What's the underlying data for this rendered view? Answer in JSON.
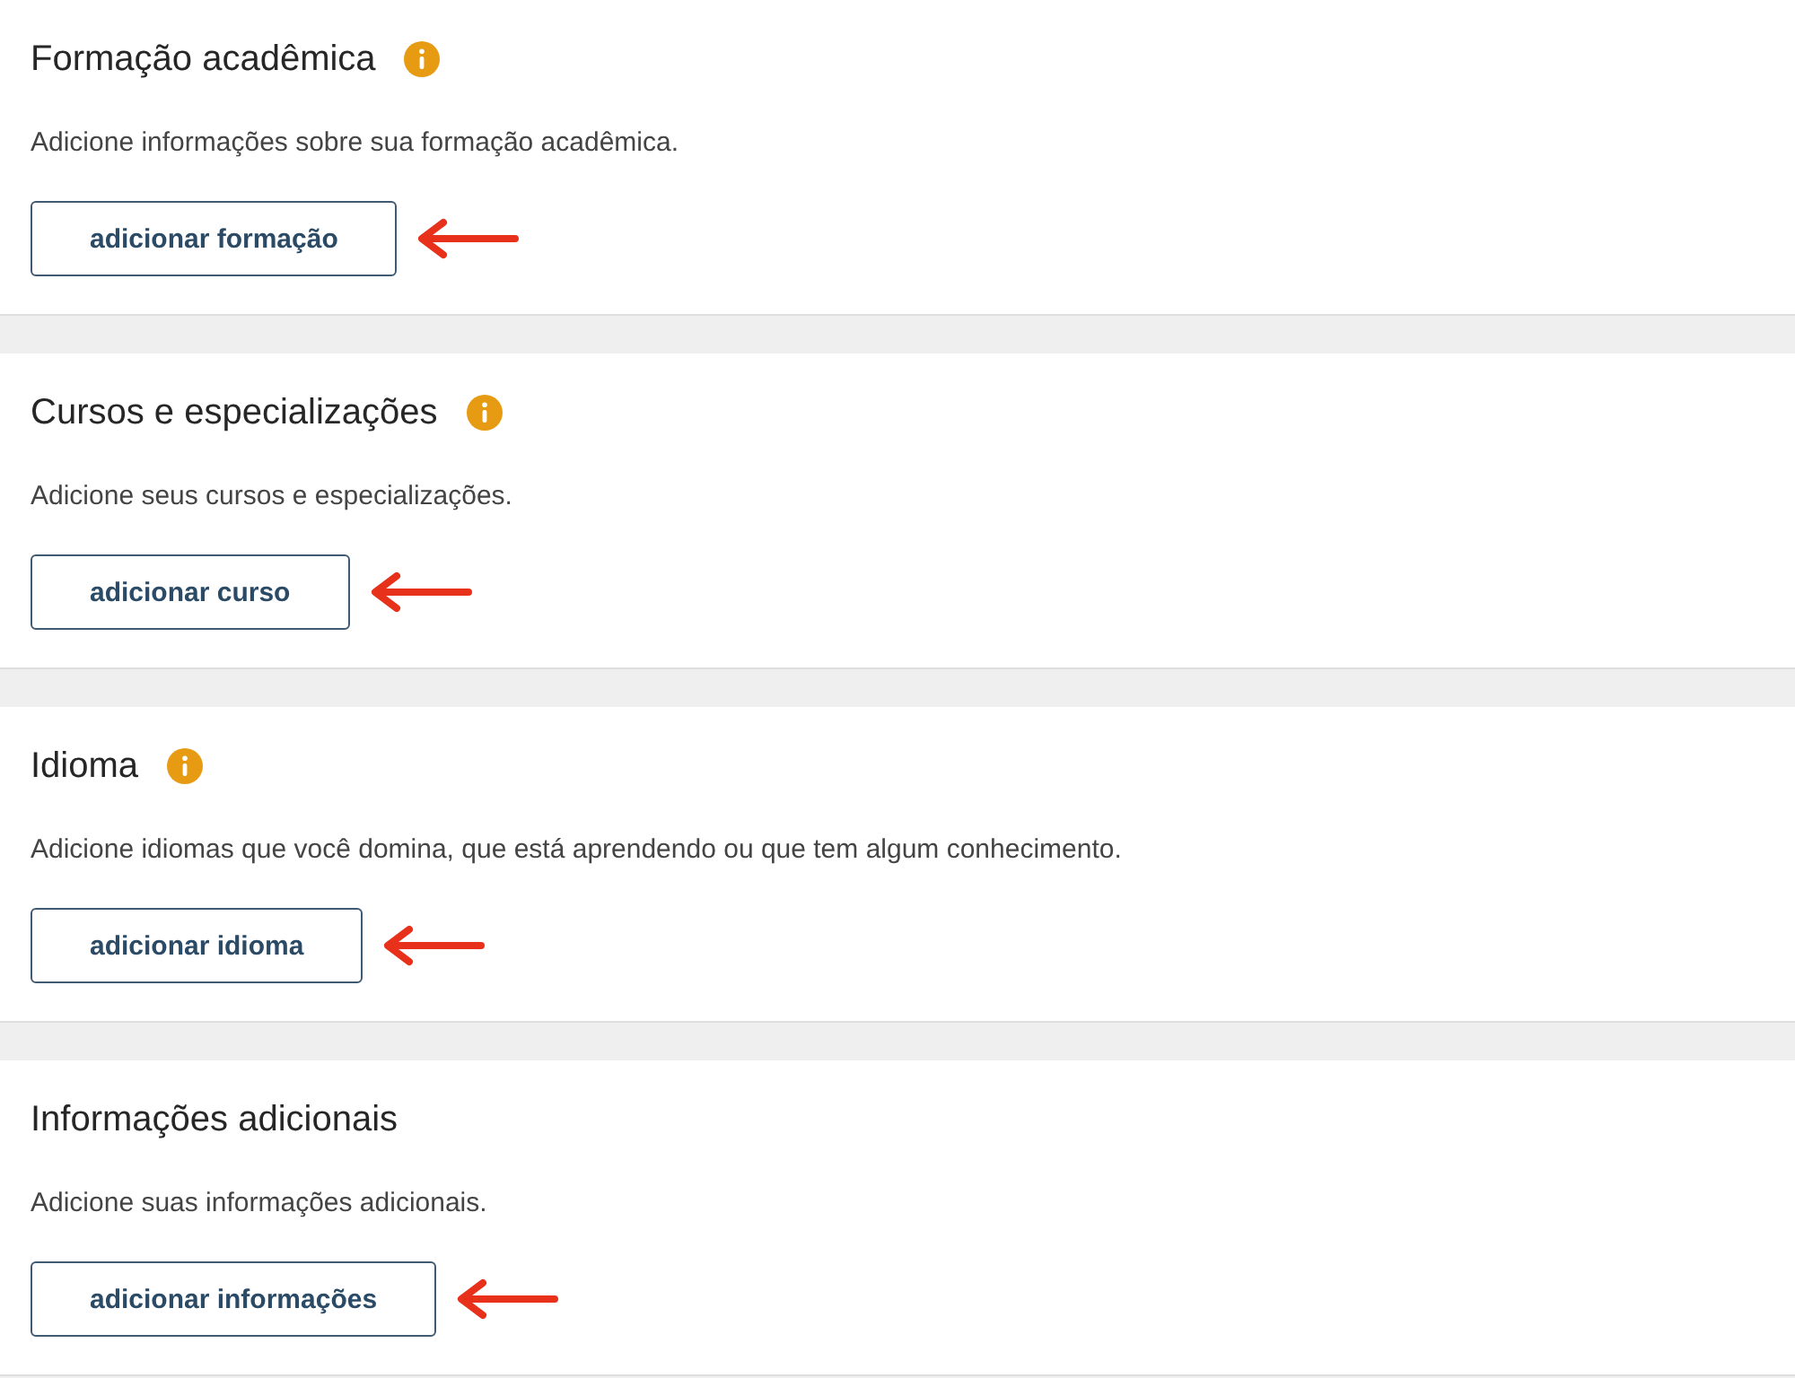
{
  "sections": [
    {
      "title": "Formação acadêmica",
      "info": true,
      "description": "Adicione informações sobre sua formação acadêmica.",
      "button": "adicionar formação",
      "arrow": true
    },
    {
      "title": "Cursos e especializações",
      "info": true,
      "description": "Adicione seus cursos e especializações.",
      "button": "adicionar curso",
      "arrow": true
    },
    {
      "title": "Idioma",
      "info": true,
      "description": "Adicione idiomas que você domina, que está aprendendo ou que tem algum conhecimento.",
      "button": "adicionar idioma",
      "arrow": true
    },
    {
      "title": "Informações adicionais",
      "info": false,
      "description": "Adicione suas informações adicionais.",
      "button": "adicionar informações",
      "arrow": true
    }
  ]
}
